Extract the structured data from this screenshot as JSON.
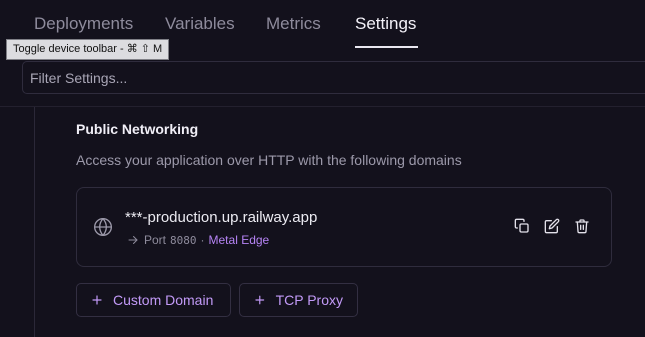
{
  "tabs": [
    {
      "label": "Deployments",
      "active": false
    },
    {
      "label": "Variables",
      "active": false
    },
    {
      "label": "Metrics",
      "active": false
    },
    {
      "label": "Settings",
      "active": true
    }
  ],
  "tooltip": {
    "text": "Toggle device toolbar - ⌘ ⇧ M"
  },
  "filter": {
    "placeholder": "Filter Settings...",
    "value": ""
  },
  "networking": {
    "title": "Public Networking",
    "description": "Access your application over HTTP with the following domains",
    "domain": {
      "url": "***-production.up.railway.app",
      "port_label": "Port",
      "port": "8080",
      "separator": "·",
      "edge": "Metal Edge"
    },
    "actions": [
      "copy-icon",
      "edit-icon",
      "trash-icon"
    ],
    "buttons": {
      "custom_domain": "Custom Domain",
      "tcp_proxy": "TCP Proxy"
    }
  },
  "colors": {
    "background": "#13111c",
    "accent": "#b684f5",
    "border": "#2f2c3d"
  }
}
